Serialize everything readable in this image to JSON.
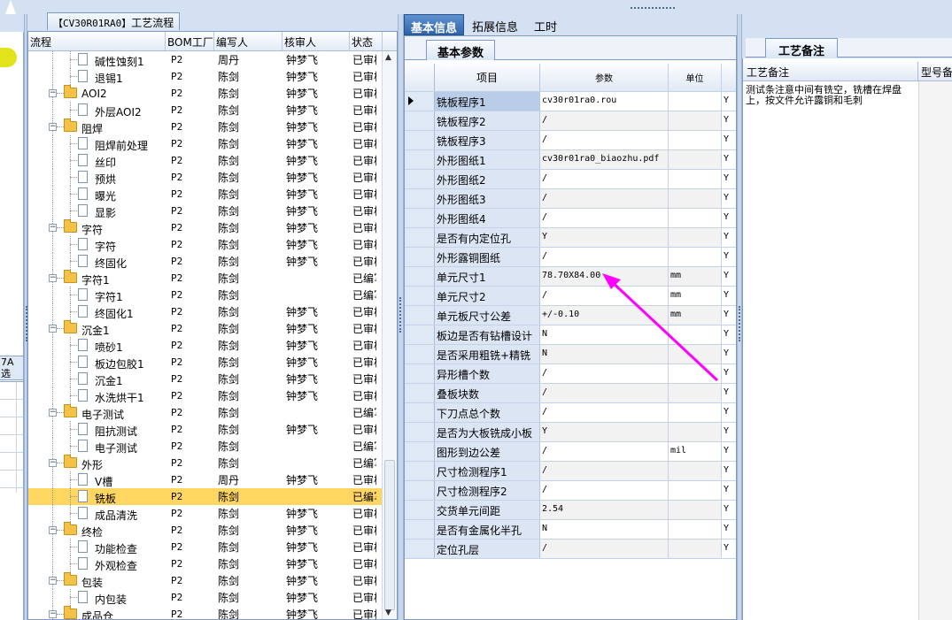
{
  "left_panel": {
    "title_code": "【CV30R01RA0】",
    "title_text": "工艺流程",
    "columns": [
      "流程",
      "BOM工厂",
      "编写人",
      "核审人",
      "状态"
    ],
    "rows": [
      {
        "name": "碱性蚀刻1",
        "type": "doc",
        "bom": "P2",
        "writer": "周丹",
        "reviewer": "钟梦飞",
        "status": "已审核"
      },
      {
        "name": "退锡1",
        "type": "doc",
        "bom": "P2",
        "writer": "陈剑",
        "reviewer": "钟梦飞",
        "status": "已审核"
      },
      {
        "name": "AOI2",
        "type": "folder",
        "bom": "P2",
        "writer": "陈剑",
        "reviewer": "钟梦飞",
        "status": "已审核"
      },
      {
        "name": "外层AOI2",
        "type": "doc",
        "bom": "P2",
        "writer": "陈剑",
        "reviewer": "钟梦飞",
        "status": "已审核"
      },
      {
        "name": "阻焊",
        "type": "folder",
        "bom": "P2",
        "writer": "陈剑",
        "reviewer": "钟梦飞",
        "status": "已审核"
      },
      {
        "name": "阻焊前处理",
        "type": "doc",
        "bom": "P2",
        "writer": "陈剑",
        "reviewer": "钟梦飞",
        "status": "已审核"
      },
      {
        "name": "丝印",
        "type": "doc",
        "bom": "P2",
        "writer": "陈剑",
        "reviewer": "钟梦飞",
        "status": "已审核"
      },
      {
        "name": "预烘",
        "type": "doc",
        "bom": "P2",
        "writer": "陈剑",
        "reviewer": "钟梦飞",
        "status": "已审核"
      },
      {
        "name": "曝光",
        "type": "doc",
        "bom": "P2",
        "writer": "陈剑",
        "reviewer": "钟梦飞",
        "status": "已审核"
      },
      {
        "name": "显影",
        "type": "doc",
        "bom": "P2",
        "writer": "陈剑",
        "reviewer": "钟梦飞",
        "status": "已审核"
      },
      {
        "name": "字符",
        "type": "folder",
        "bom": "P2",
        "writer": "陈剑",
        "reviewer": "钟梦飞",
        "status": "已审核"
      },
      {
        "name": "字符",
        "type": "doc",
        "bom": "P2",
        "writer": "陈剑",
        "reviewer": "钟梦飞",
        "status": "已审核"
      },
      {
        "name": "终固化",
        "type": "doc",
        "bom": "P2",
        "writer": "陈剑",
        "reviewer": "钟梦飞",
        "status": "已审核"
      },
      {
        "name": "字符1",
        "type": "folder",
        "bom": "P2",
        "writer": "陈剑",
        "reviewer": "",
        "status": "已编写"
      },
      {
        "name": "字符1",
        "type": "doc",
        "bom": "P2",
        "writer": "陈剑",
        "reviewer": "",
        "status": "已编写"
      },
      {
        "name": "终固化1",
        "type": "doc",
        "bom": "P2",
        "writer": "陈剑",
        "reviewer": "钟梦飞",
        "status": "已审核"
      },
      {
        "name": "沉金1",
        "type": "folder",
        "bom": "P2",
        "writer": "陈剑",
        "reviewer": "钟梦飞",
        "status": "已审核"
      },
      {
        "name": "喷砂1",
        "type": "doc",
        "bom": "P2",
        "writer": "陈剑",
        "reviewer": "钟梦飞",
        "status": "已审核"
      },
      {
        "name": "板边包胶1",
        "type": "doc",
        "bom": "P2",
        "writer": "陈剑",
        "reviewer": "钟梦飞",
        "status": "已审核"
      },
      {
        "name": "沉金1",
        "type": "doc",
        "bom": "P2",
        "writer": "陈剑",
        "reviewer": "钟梦飞",
        "status": "已审核"
      },
      {
        "name": "水洗烘干1",
        "type": "doc",
        "bom": "P2",
        "writer": "陈剑",
        "reviewer": "钟梦飞",
        "status": "已审核"
      },
      {
        "name": "电子测试",
        "type": "folder",
        "bom": "P2",
        "writer": "陈剑",
        "reviewer": "",
        "status": "已编写"
      },
      {
        "name": "阻抗测试",
        "type": "doc",
        "bom": "P2",
        "writer": "陈剑",
        "reviewer": "钟梦飞",
        "status": "已审核"
      },
      {
        "name": "电子测试",
        "type": "doc",
        "bom": "P2",
        "writer": "陈剑",
        "reviewer": "",
        "status": "已编写"
      },
      {
        "name": "外形",
        "type": "folder",
        "bom": "P2",
        "writer": "陈剑",
        "reviewer": "",
        "status": "已编写"
      },
      {
        "name": "V槽",
        "type": "doc",
        "bom": "P2",
        "writer": "周丹",
        "reviewer": "钟梦飞",
        "status": "已审核"
      },
      {
        "name": "铣板",
        "type": "doc",
        "bom": "P2",
        "writer": "陈剑",
        "reviewer": "",
        "status": "已编写",
        "selected": true
      },
      {
        "name": "成品清洗",
        "type": "doc",
        "bom": "P2",
        "writer": "陈剑",
        "reviewer": "钟梦飞",
        "status": "已审核"
      },
      {
        "name": "终检",
        "type": "folder",
        "bom": "P2",
        "writer": "陈剑",
        "reviewer": "钟梦飞",
        "status": "已审核"
      },
      {
        "name": "功能检查",
        "type": "doc",
        "bom": "P2",
        "writer": "陈剑",
        "reviewer": "钟梦飞",
        "status": "已审核"
      },
      {
        "name": "外观检查",
        "type": "doc",
        "bom": "P2",
        "writer": "陈剑",
        "reviewer": "钟梦飞",
        "status": "已审核"
      },
      {
        "name": "包装",
        "type": "folder",
        "bom": "P2",
        "writer": "陈剑",
        "reviewer": "钟梦飞",
        "status": "已审核"
      },
      {
        "name": "内包装",
        "type": "doc",
        "bom": "P2",
        "writer": "陈剑",
        "reviewer": "钟梦飞",
        "status": "已审核"
      },
      {
        "name": "成品仓",
        "type": "folder",
        "bom": "P2",
        "writer": "陈剑",
        "reviewer": "钟梦飞",
        "status": "已审核"
      }
    ]
  },
  "far_left": {
    "label_line1": "7A",
    "label_line2": "选"
  },
  "center": {
    "tabs": [
      "基本信息",
      "拓展信息",
      "工时"
    ],
    "subtab": "基本参数",
    "grid_headers": {
      "item": "项目",
      "param": "参数",
      "unit": "单位"
    },
    "rows": [
      {
        "item": "铣板程序1",
        "param": "cv30r01ra0.rou",
        "unit": "",
        "flag": "Y"
      },
      {
        "item": "铣板程序2",
        "param": "/",
        "unit": "",
        "flag": "Y"
      },
      {
        "item": "铣板程序3",
        "param": "/",
        "unit": "",
        "flag": "Y"
      },
      {
        "item": "外形图纸1",
        "param": "cv30r01ra0_biaozhu.pdf",
        "unit": "",
        "flag": "Y"
      },
      {
        "item": "外形图纸2",
        "param": "/",
        "unit": "",
        "flag": "Y"
      },
      {
        "item": "外形图纸3",
        "param": "/",
        "unit": "",
        "flag": "Y"
      },
      {
        "item": "外形图纸4",
        "param": "/",
        "unit": "",
        "flag": "Y"
      },
      {
        "item": "是否有内定位孔",
        "param": "Y",
        "unit": "",
        "flag": "Y"
      },
      {
        "item": "外形露铜图纸",
        "param": "/",
        "unit": "",
        "flag": "Y"
      },
      {
        "item": "单元尺寸1",
        "param": "78.70X84.00",
        "unit": "mm",
        "flag": "Y"
      },
      {
        "item": "单元尺寸2",
        "param": "/",
        "unit": "mm",
        "flag": "Y"
      },
      {
        "item": "单元板尺寸公差",
        "param": "+/-0.10",
        "unit": "mm",
        "flag": "Y"
      },
      {
        "item": "板边是否有钻槽设计",
        "param": "N",
        "unit": "",
        "flag": "Y"
      },
      {
        "item": "是否采用粗铣+精铣",
        "param": "N",
        "unit": "",
        "flag": "Y"
      },
      {
        "item": "异形槽个数",
        "param": "/",
        "unit": "",
        "flag": "Y"
      },
      {
        "item": "叠板块数",
        "param": "/",
        "unit": "",
        "flag": "Y"
      },
      {
        "item": "下刀点总个数",
        "param": "/",
        "unit": "",
        "flag": "Y"
      },
      {
        "item": "是否为大板铣成小板",
        "param": "Y",
        "unit": "",
        "flag": "Y"
      },
      {
        "item": "图形到边公差",
        "param": "/",
        "unit": "mil",
        "flag": "Y"
      },
      {
        "item": "尺寸检测程序1",
        "param": "/",
        "unit": "",
        "flag": "Y"
      },
      {
        "item": "尺寸检测程序2",
        "param": "/",
        "unit": "",
        "flag": "Y"
      },
      {
        "item": "交货单元间距",
        "param": "2.54",
        "unit": "",
        "flag": "Y"
      },
      {
        "item": "是否有金属化半孔",
        "param": "N",
        "unit": "",
        "flag": "Y"
      },
      {
        "item": "定位孔层",
        "param": "/",
        "unit": "",
        "flag": "Y"
      }
    ]
  },
  "right": {
    "tab": "工艺备注",
    "col1": "工艺备注",
    "col2": "型号备",
    "note": "测试条注意中间有铣空，铣槽在焊盘上，按文件允许露铜和毛刺"
  },
  "colors": {
    "selected_row": "#ffd660",
    "active_tab": "#2f63a8",
    "annotation_arrow": "#ff00ff"
  }
}
